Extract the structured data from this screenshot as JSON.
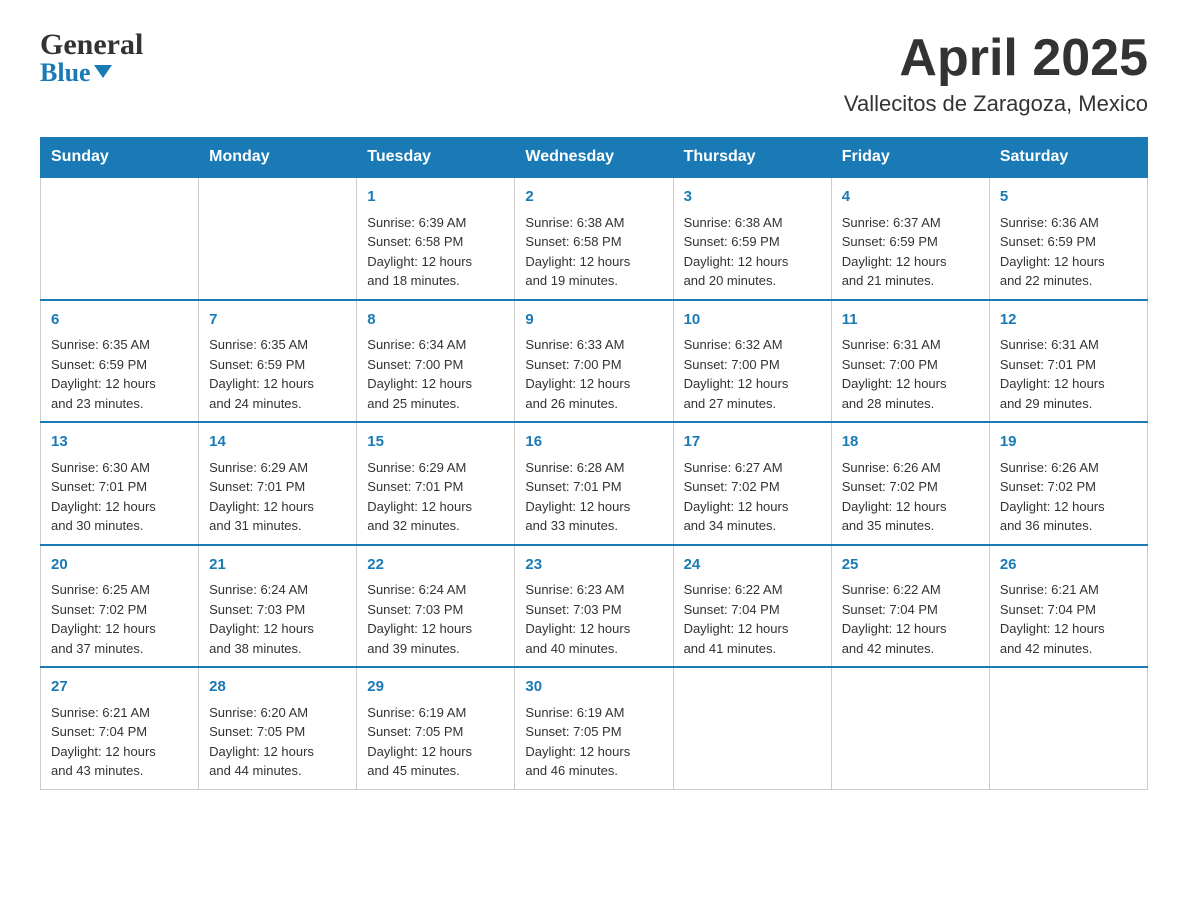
{
  "header": {
    "logo_top": "General",
    "logo_bottom": "Blue",
    "title": "April 2025",
    "subtitle": "Vallecitos de Zaragoza, Mexico"
  },
  "calendar": {
    "days_of_week": [
      "Sunday",
      "Monday",
      "Tuesday",
      "Wednesday",
      "Thursday",
      "Friday",
      "Saturday"
    ],
    "weeks": [
      [
        {
          "day": "",
          "info": ""
        },
        {
          "day": "",
          "info": ""
        },
        {
          "day": "1",
          "info": "Sunrise: 6:39 AM\nSunset: 6:58 PM\nDaylight: 12 hours\nand 18 minutes."
        },
        {
          "day": "2",
          "info": "Sunrise: 6:38 AM\nSunset: 6:58 PM\nDaylight: 12 hours\nand 19 minutes."
        },
        {
          "day": "3",
          "info": "Sunrise: 6:38 AM\nSunset: 6:59 PM\nDaylight: 12 hours\nand 20 minutes."
        },
        {
          "day": "4",
          "info": "Sunrise: 6:37 AM\nSunset: 6:59 PM\nDaylight: 12 hours\nand 21 minutes."
        },
        {
          "day": "5",
          "info": "Sunrise: 6:36 AM\nSunset: 6:59 PM\nDaylight: 12 hours\nand 22 minutes."
        }
      ],
      [
        {
          "day": "6",
          "info": "Sunrise: 6:35 AM\nSunset: 6:59 PM\nDaylight: 12 hours\nand 23 minutes."
        },
        {
          "day": "7",
          "info": "Sunrise: 6:35 AM\nSunset: 6:59 PM\nDaylight: 12 hours\nand 24 minutes."
        },
        {
          "day": "8",
          "info": "Sunrise: 6:34 AM\nSunset: 7:00 PM\nDaylight: 12 hours\nand 25 minutes."
        },
        {
          "day": "9",
          "info": "Sunrise: 6:33 AM\nSunset: 7:00 PM\nDaylight: 12 hours\nand 26 minutes."
        },
        {
          "day": "10",
          "info": "Sunrise: 6:32 AM\nSunset: 7:00 PM\nDaylight: 12 hours\nand 27 minutes."
        },
        {
          "day": "11",
          "info": "Sunrise: 6:31 AM\nSunset: 7:00 PM\nDaylight: 12 hours\nand 28 minutes."
        },
        {
          "day": "12",
          "info": "Sunrise: 6:31 AM\nSunset: 7:01 PM\nDaylight: 12 hours\nand 29 minutes."
        }
      ],
      [
        {
          "day": "13",
          "info": "Sunrise: 6:30 AM\nSunset: 7:01 PM\nDaylight: 12 hours\nand 30 minutes."
        },
        {
          "day": "14",
          "info": "Sunrise: 6:29 AM\nSunset: 7:01 PM\nDaylight: 12 hours\nand 31 minutes."
        },
        {
          "day": "15",
          "info": "Sunrise: 6:29 AM\nSunset: 7:01 PM\nDaylight: 12 hours\nand 32 minutes."
        },
        {
          "day": "16",
          "info": "Sunrise: 6:28 AM\nSunset: 7:01 PM\nDaylight: 12 hours\nand 33 minutes."
        },
        {
          "day": "17",
          "info": "Sunrise: 6:27 AM\nSunset: 7:02 PM\nDaylight: 12 hours\nand 34 minutes."
        },
        {
          "day": "18",
          "info": "Sunrise: 6:26 AM\nSunset: 7:02 PM\nDaylight: 12 hours\nand 35 minutes."
        },
        {
          "day": "19",
          "info": "Sunrise: 6:26 AM\nSunset: 7:02 PM\nDaylight: 12 hours\nand 36 minutes."
        }
      ],
      [
        {
          "day": "20",
          "info": "Sunrise: 6:25 AM\nSunset: 7:02 PM\nDaylight: 12 hours\nand 37 minutes."
        },
        {
          "day": "21",
          "info": "Sunrise: 6:24 AM\nSunset: 7:03 PM\nDaylight: 12 hours\nand 38 minutes."
        },
        {
          "day": "22",
          "info": "Sunrise: 6:24 AM\nSunset: 7:03 PM\nDaylight: 12 hours\nand 39 minutes."
        },
        {
          "day": "23",
          "info": "Sunrise: 6:23 AM\nSunset: 7:03 PM\nDaylight: 12 hours\nand 40 minutes."
        },
        {
          "day": "24",
          "info": "Sunrise: 6:22 AM\nSunset: 7:04 PM\nDaylight: 12 hours\nand 41 minutes."
        },
        {
          "day": "25",
          "info": "Sunrise: 6:22 AM\nSunset: 7:04 PM\nDaylight: 12 hours\nand 42 minutes."
        },
        {
          "day": "26",
          "info": "Sunrise: 6:21 AM\nSunset: 7:04 PM\nDaylight: 12 hours\nand 42 minutes."
        }
      ],
      [
        {
          "day": "27",
          "info": "Sunrise: 6:21 AM\nSunset: 7:04 PM\nDaylight: 12 hours\nand 43 minutes."
        },
        {
          "day": "28",
          "info": "Sunrise: 6:20 AM\nSunset: 7:05 PM\nDaylight: 12 hours\nand 44 minutes."
        },
        {
          "day": "29",
          "info": "Sunrise: 6:19 AM\nSunset: 7:05 PM\nDaylight: 12 hours\nand 45 minutes."
        },
        {
          "day": "30",
          "info": "Sunrise: 6:19 AM\nSunset: 7:05 PM\nDaylight: 12 hours\nand 46 minutes."
        },
        {
          "day": "",
          "info": ""
        },
        {
          "day": "",
          "info": ""
        },
        {
          "day": "",
          "info": ""
        }
      ]
    ]
  }
}
